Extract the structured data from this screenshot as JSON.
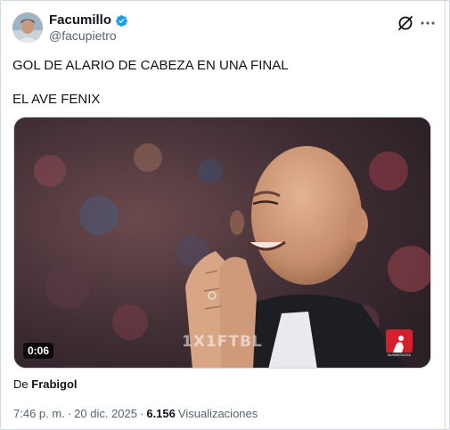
{
  "author": {
    "display_name": "Facumillo",
    "handle": "@facupietro",
    "verified": true,
    "avatar_icon": "avatar-photo"
  },
  "header_actions": {
    "grok_icon": "grok-icon",
    "more_icon": "more-horizontal-icon"
  },
  "tweet": {
    "line1": "GOL DE ALARIO DE CABEZA EN UNA FINAL",
    "line2": "EL AVE FENIX"
  },
  "media": {
    "duration": "0:06",
    "watermark": "1X1FTBL",
    "broadcaster_logo_icon": "bundesliga-logo-icon",
    "broadcaster_caption": "BUNDESLIGA"
  },
  "source": {
    "prefix": "De",
    "name": "Frabigol"
  },
  "meta": {
    "time": "7:46 p. m.",
    "separator": "·",
    "date": "20 dic. 2025",
    "views_count": "6.156",
    "views_label": "Visualizaciones"
  },
  "colors": {
    "verified_blue": "#1d9bf0",
    "secondary_text": "#536471",
    "border": "#cfd9de",
    "bundesliga_red": "#d3202a"
  }
}
